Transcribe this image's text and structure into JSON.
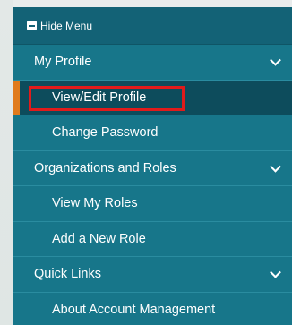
{
  "menu": {
    "hide_label": "Hide Menu",
    "sections": [
      {
        "label": "My Profile",
        "items": [
          {
            "label": "View/Edit Profile",
            "active": true
          },
          {
            "label": "Change Password"
          }
        ]
      },
      {
        "label": "Organizations and Roles",
        "items": [
          {
            "label": "View My Roles"
          },
          {
            "label": "Add a New Role"
          }
        ]
      },
      {
        "label": "Quick Links",
        "items": [
          {
            "label": "About Account Management"
          }
        ]
      }
    ]
  },
  "icons": {
    "hide": "minus-square-icon",
    "expand": "chevron-down-icon"
  },
  "colors": {
    "menu_bg": "#17768a",
    "header_bg": "#136276",
    "active_bg": "#0d4c5c",
    "active_marker": "#e07b1d",
    "highlight_border": "#e11b1b"
  }
}
